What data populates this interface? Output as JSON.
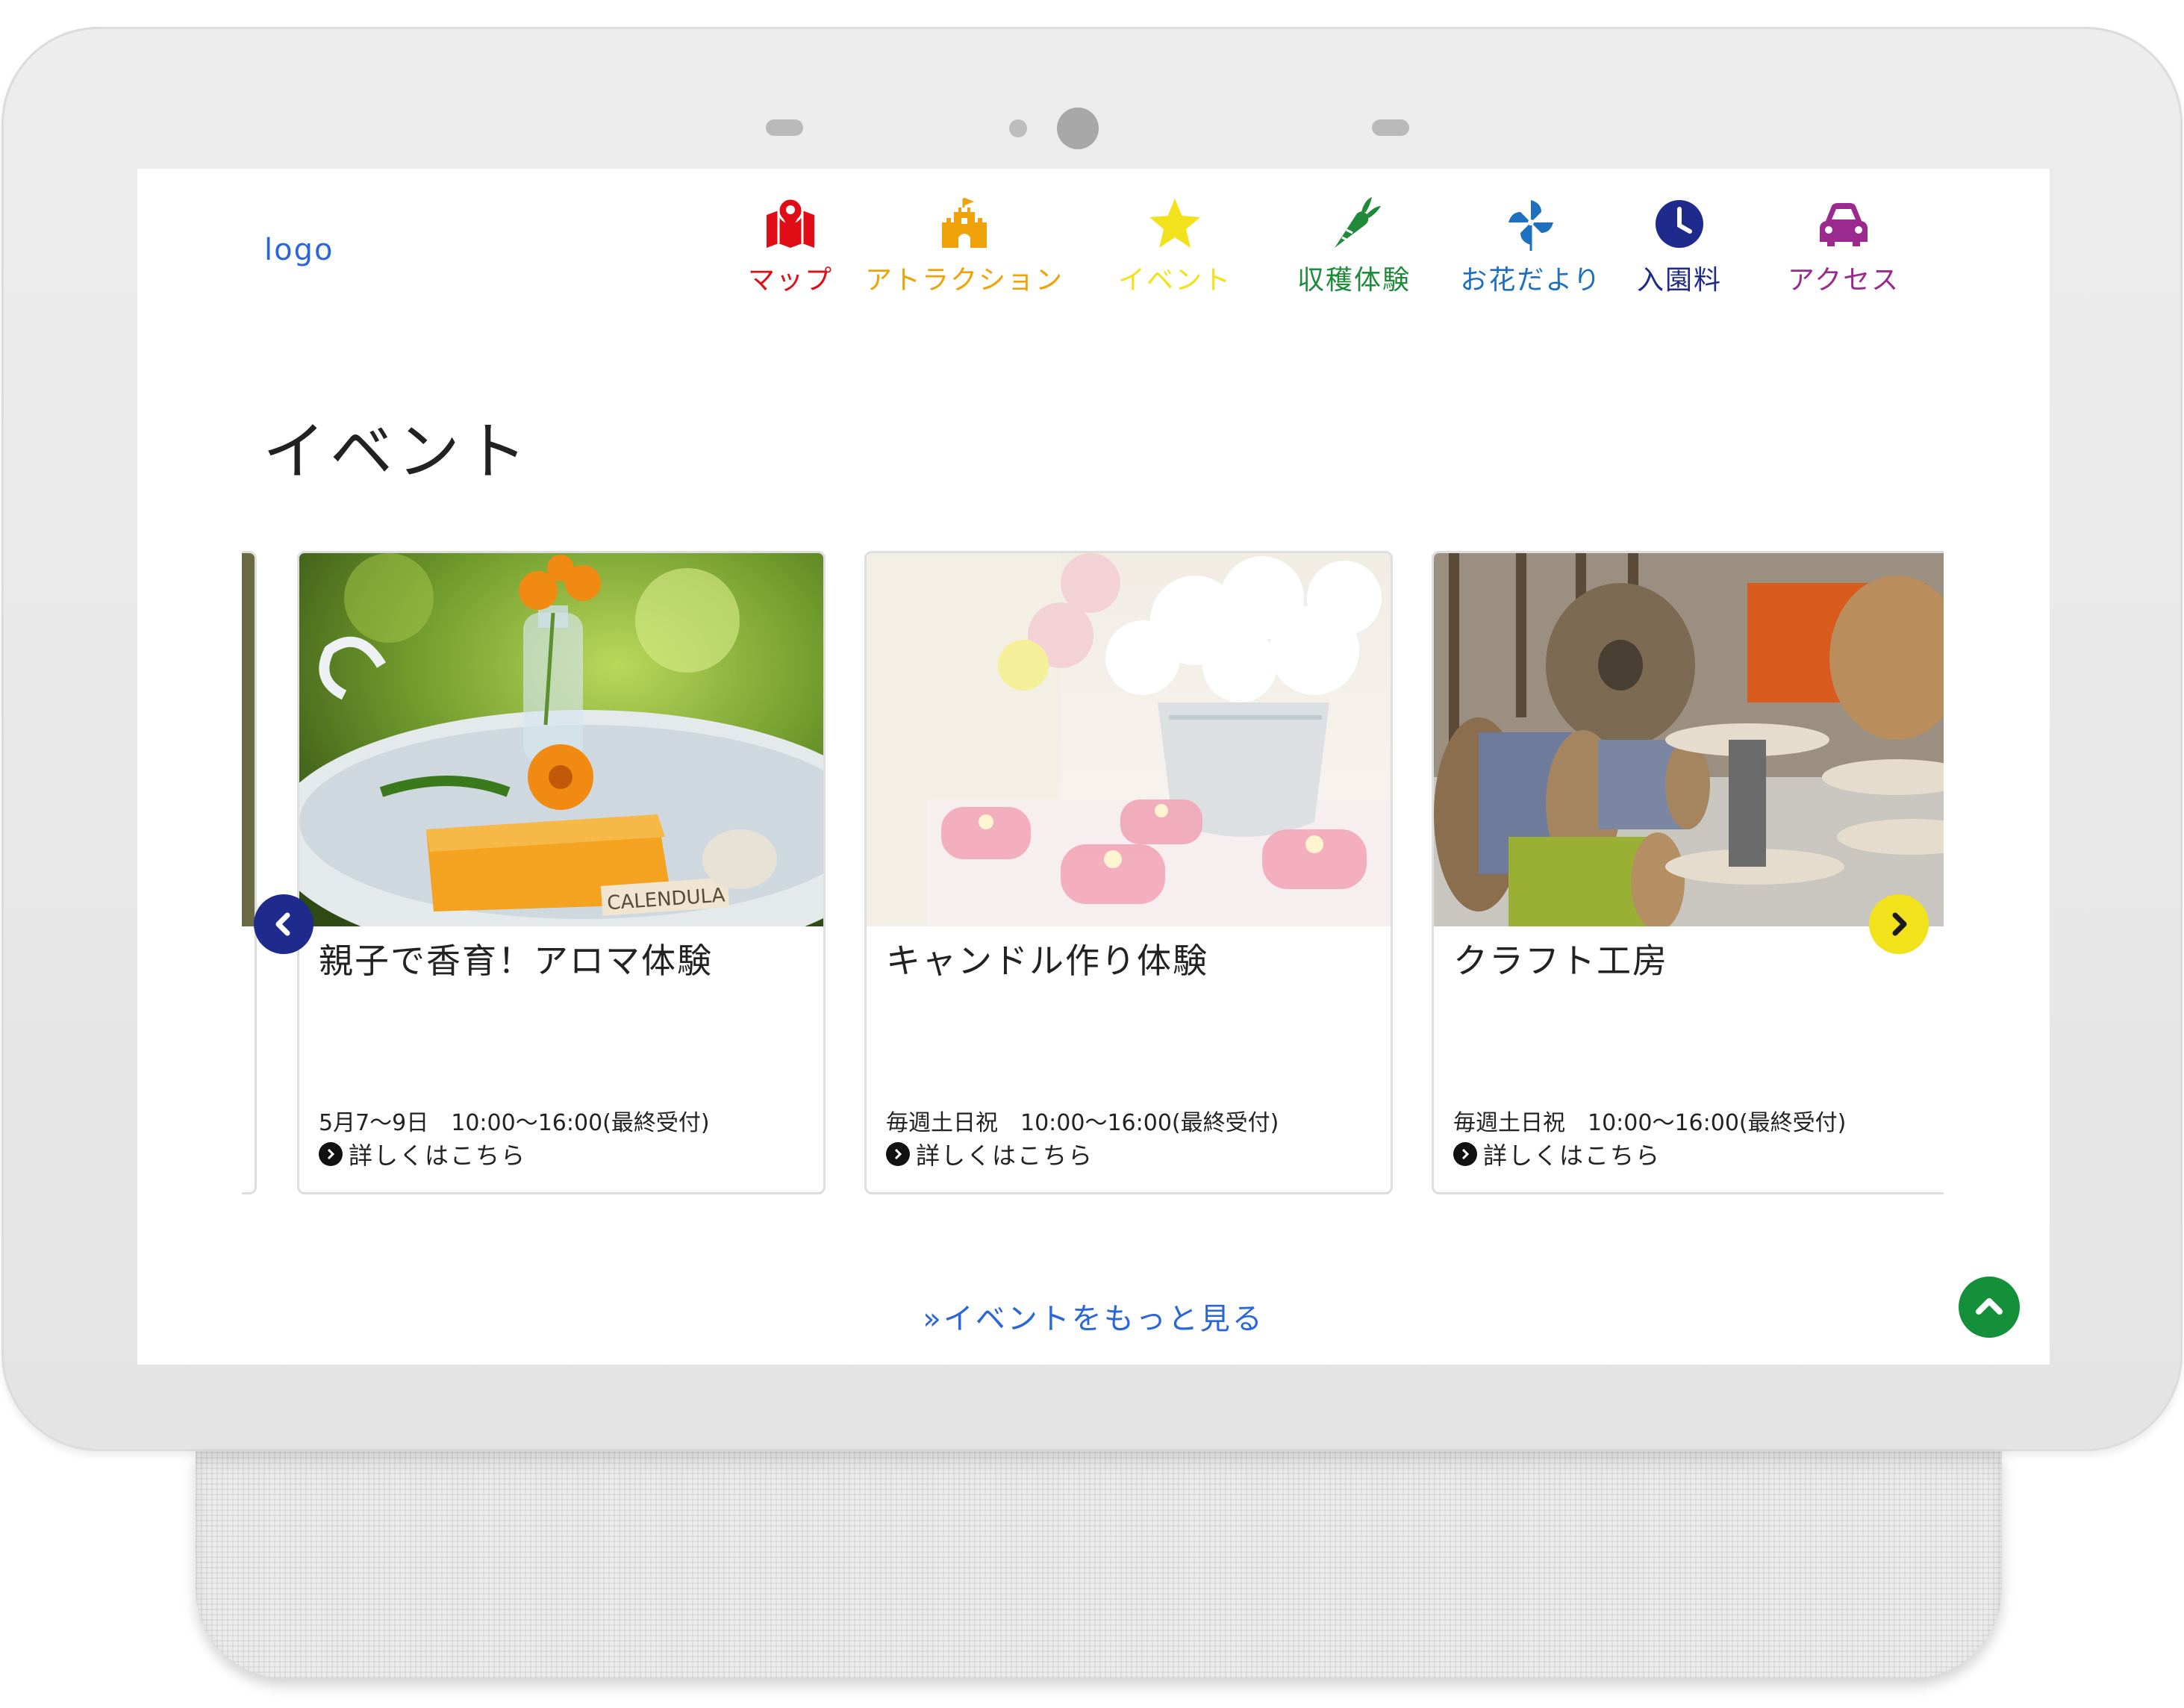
{
  "header": {
    "logo": "logo"
  },
  "nav": [
    {
      "label": "マップ",
      "icon": "map-pin-icon",
      "color": "#e10d16"
    },
    {
      "label": "アトラクション",
      "icon": "castle-icon",
      "color": "#f0a20a"
    },
    {
      "label": "イベント",
      "icon": "star-icon",
      "color": "#f2e21b"
    },
    {
      "label": "収穫体験",
      "icon": "carrot-icon",
      "color": "#1f8a3a"
    },
    {
      "label": "お花だより",
      "icon": "pinwheel-icon",
      "color": "#1f6fc0"
    },
    {
      "label": "入園料",
      "icon": "clock-icon",
      "color": "#1e2a8c"
    },
    {
      "label": "アクセス",
      "icon": "car-icon",
      "color": "#9b2a8f"
    }
  ],
  "main": {
    "title": "イベント",
    "cards": [
      {
        "title": "親子で香育！アロマ体験",
        "date": "5月7～9日　10:00～16:00(最終受付)",
        "more": "詳しくはこちら",
        "image": "calendula-soap-photo",
        "image_text": "CALENDULA"
      },
      {
        "title": "キャンドル作り体験",
        "date": "毎週土日祝　10:00～16:00(最終受付)",
        "more": "詳しくはこちら",
        "image": "candles-flowers-photo"
      },
      {
        "title": "クラフト工房",
        "date": "毎週土日祝　10:00～16:00(最終受付)",
        "more": "詳しくはこちら",
        "image": "cable-spools-photo"
      }
    ],
    "see_more": "»イベントをもっと見る"
  },
  "colors": {
    "link_blue": "#2b66d9",
    "prev_arrow": "#1e2a8c",
    "next_arrow": "#f2e21b",
    "back_to_top": "#14903a"
  }
}
